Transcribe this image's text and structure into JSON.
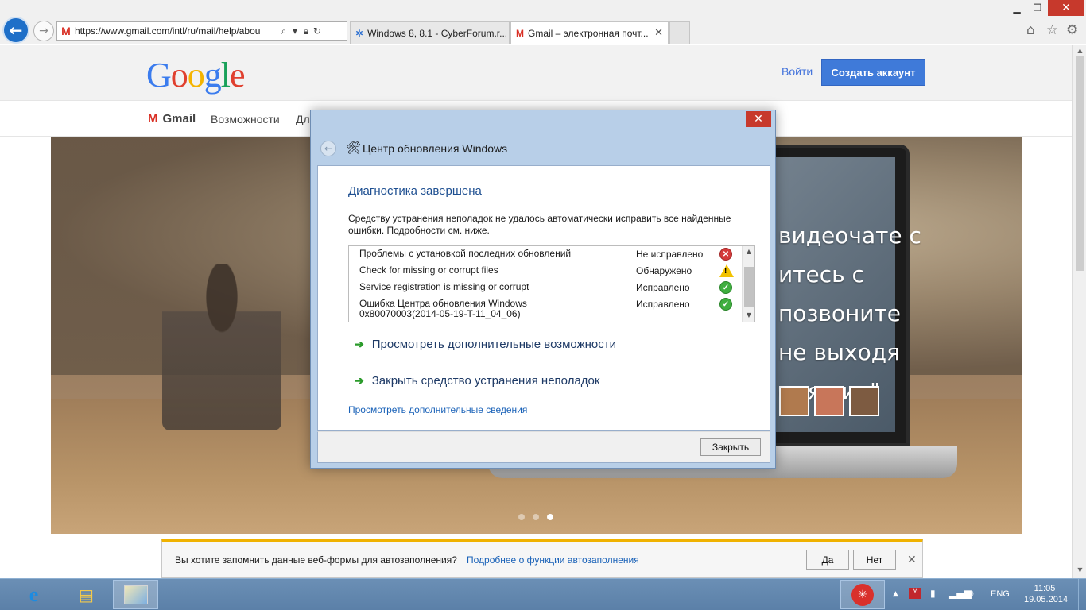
{
  "browser": {
    "address": "https://www.gmail.com/intl/ru/mail/help/abou",
    "tabs": [
      {
        "label": "Windows 8, 8.1 - CyberForum.r..."
      },
      {
        "label": "Gmail – электронная почт..."
      }
    ],
    "window_controls": {
      "minimize": "▁",
      "maximize": "❐",
      "close": "✕"
    },
    "icons": {
      "home": "home-icon",
      "favorites": "star-icon",
      "settings": "gear-icon",
      "back": "back-arrow-icon",
      "forward": "forward-arrow-icon"
    }
  },
  "gmail_page": {
    "logo_letters": [
      "G",
      "o",
      "o",
      "g",
      "l",
      "e"
    ],
    "signin": "Войти",
    "create_account": "Создать аккаунт",
    "nav": {
      "brand": "Gmail",
      "features": "Возможности",
      "business_partial": "Дл"
    },
    "hero_text": [
      "видеочате с",
      "итесь с",
      "позвоните",
      "не выходя",
      "одящие\""
    ],
    "carousel": {
      "count": 3,
      "active": 3
    }
  },
  "dialog": {
    "title": "Центр обновления Windows",
    "heading": "Диагностика завершена",
    "description": "Средству устранения неполадок не удалось автоматически исправить все найденные ошибки. Подробности см. ниже.",
    "results": [
      {
        "name": "Проблемы с установкой последних обновлений",
        "status": "Не исправлено",
        "icon": "error-icon"
      },
      {
        "name": "Check for missing or corrupt files",
        "status": "Обнаружено",
        "icon": "warning-icon"
      },
      {
        "name": "Service registration is missing or corrupt",
        "status": "Исправлено",
        "icon": "check-icon"
      },
      {
        "name": "Ошибка Центра обновления Windows",
        "name_line2": "0x80070003(2014-05-19-T-11_04_06)",
        "status": "Исправлено",
        "icon": "check-icon"
      }
    ],
    "action_more": "Просмотреть дополнительные возможности",
    "action_close": "Закрыть средство устранения неполадок",
    "details_link": "Просмотреть дополнительные сведения",
    "close_button": "Закрыть"
  },
  "notification": {
    "text": "Вы хотите запомнить данные веб-формы для автозаполнения?",
    "link": "Подробнее о функции автозаполнения",
    "yes": "Да",
    "no": "Нет"
  },
  "taskbar": {
    "language": "ENG",
    "time": "11:05",
    "date": "19.05.2014"
  },
  "colors": {
    "accent_blue": "#3f7ad9",
    "dialog_heading": "#1e4f91",
    "close_red": "#c7392c",
    "notify_yellow": "#f0b200",
    "taskbar": "#5b80a8"
  }
}
